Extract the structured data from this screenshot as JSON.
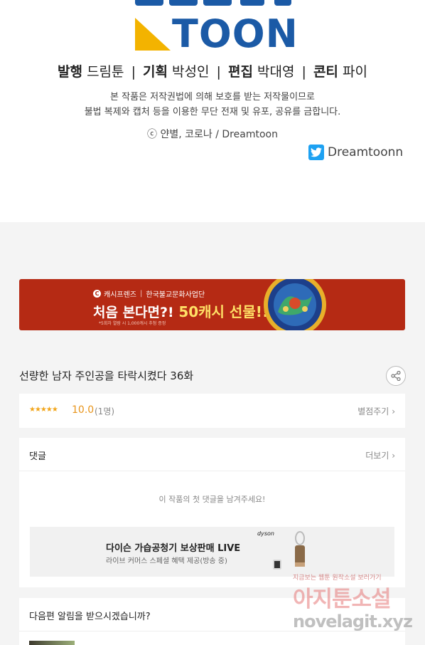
{
  "header": {
    "logo_text": "TOON",
    "credits": [
      {
        "role": "발행",
        "name": "드림툰"
      },
      {
        "role": "기획",
        "name": "박성인"
      },
      {
        "role": "편집",
        "name": "박대영"
      },
      {
        "role": "콘티",
        "name": "파이"
      }
    ],
    "copyright_line1": "본 작품은 저작권법에 의해 보호를 받는 저작물이므로",
    "copyright_line2": "불법 복제와 캡처 등을 이용한 무단 전재 및 유포, 공유를 금합니다.",
    "copyright_owner": "ⓒ 얀별, 코로나 / Dreamtoon",
    "twitter_handle": "Dreamtoonn"
  },
  "banner": {
    "brand_left": "캐시프렌즈",
    "brand_right": "한국불교문화사업단",
    "headline_prefix": "처음 본다면?!",
    "headline_highlight": "50캐시 선물!!",
    "fine_print": "*5회차 열람 시 1,000캐시 추첨 증정",
    "accent_color": "#b52a14"
  },
  "episode": {
    "title": "선량한 남자 주인공을 타락시켰다 36화",
    "share_icon": "share-icon"
  },
  "rating": {
    "stars": "★★★★★",
    "score": "10.0",
    "count": "(1명)",
    "rate_button": "별점주기"
  },
  "comments": {
    "header": "댓글",
    "more_button": "더보기",
    "empty_message": "이 작품의 첫 댓글을 남겨주세요!",
    "ad_title": "다이슨 가습공청기 보상판매 LIVE",
    "ad_subtitle": "라이브 커머스 스페셜 혜택 제공(방송 중)",
    "ad_brand": "dyson"
  },
  "notify": {
    "question": "다음편 알림을 받으시겠습니까?"
  },
  "watermark": {
    "top_line": "지금보는 웹툰 원작소설 보러가기",
    "main_text": "아지툰소설",
    "url": "novelagit.xyz"
  }
}
